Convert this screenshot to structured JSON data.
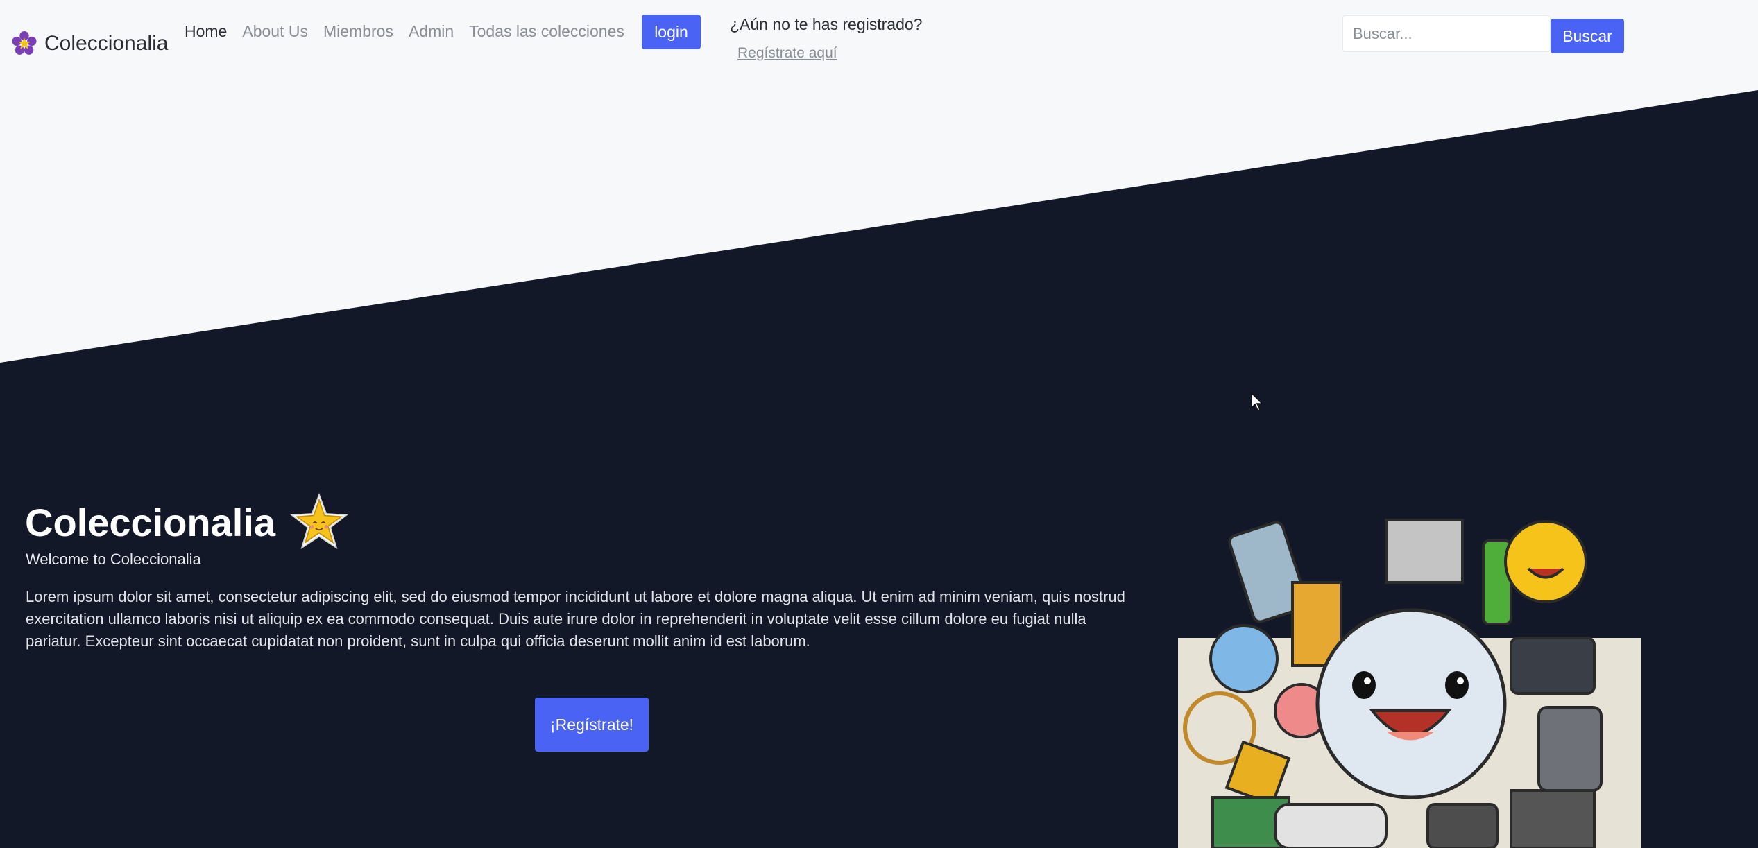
{
  "brand": {
    "name": "Coleccionalia",
    "logo_icon": "flower-star-logo-icon"
  },
  "nav": {
    "links": [
      "Home",
      "About Us",
      "Miembros",
      "Admin",
      "Todas las colecciones"
    ],
    "active_index": 0
  },
  "auth": {
    "login_label": "login",
    "register_question": "¿Aún no te has registrado?",
    "register_link": "Regístrate aquí"
  },
  "search": {
    "placeholder": "Buscar...",
    "value": "",
    "button_label": "Buscar"
  },
  "hero": {
    "title": "Coleccionalia",
    "title_icon": "smiling-star-icon",
    "subtitle": "Welcome to Coleccionalia",
    "body": "Lorem ipsum dolor sit amet, consectetur adipiscing elit, sed do eiusmod tempor incididunt ut labore et dolore magna aliqua. Ut enim ad minim veniam, quis nostrud exercitation ullamco laboris nisi ut aliquip ex ea commodo consequat. Duis aute irure dolor in reprehenderit in voluptate velit esse cillum dolore eu fugiat nulla pariatur. Excepteur sint occaecat cupidatat non proident, sunt in culpa qui officia deserunt mollit anim id est laborum.",
    "cta_label": "¡Regístrate!",
    "illustration": "collectibles-pile-illustration"
  },
  "colors": {
    "accent": "#4a63f5",
    "dark_bg": "#131828",
    "light_bg": "#f7f8f9"
  }
}
